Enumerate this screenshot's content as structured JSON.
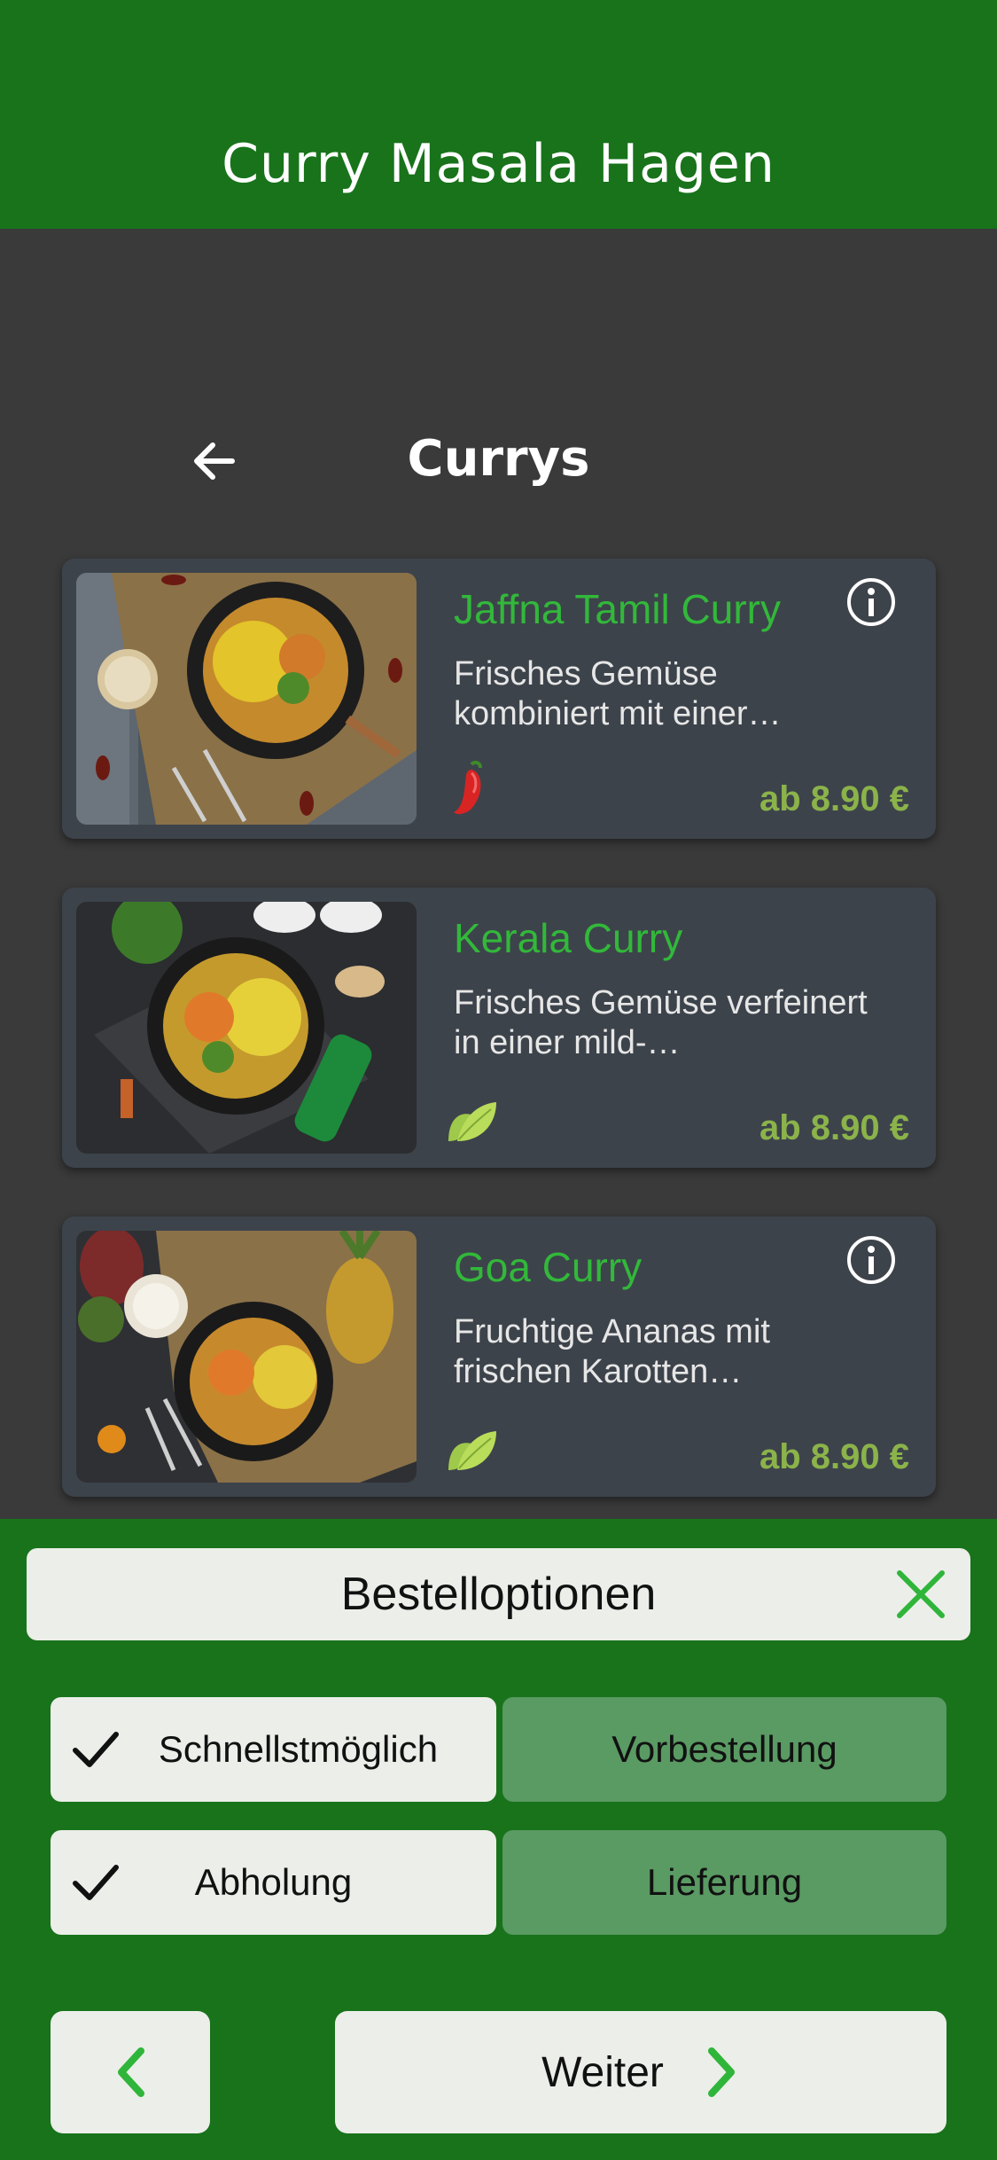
{
  "app": {
    "title": "Curry Masala Hagen",
    "brand_color": "#18731b",
    "accent_green": "#32b83a",
    "price_color": "#8bb34a"
  },
  "section": {
    "title": "Currys",
    "back_icon": "arrow-left-icon"
  },
  "menu_items": [
    {
      "name": "Jaffna Tamil Curry",
      "description": "Frisches Gemüse kombiniert mit einer…",
      "price": "ab 8.90 €",
      "tag_icon": "chili-icon",
      "has_info": true
    },
    {
      "name": "Kerala Curry",
      "description": "Frisches Gemüse verfeinert in einer mild-…",
      "price": "ab 8.90 €",
      "tag_icon": "vegan-leaf-icon",
      "has_info": false
    },
    {
      "name": "Goa Curry",
      "description": "Fruchtige Ananas mit frischen Karotten…",
      "price": "ab 8.90 €",
      "tag_icon": "vegan-leaf-icon",
      "has_info": true
    }
  ],
  "order_options": {
    "title": "Bestelloptionen",
    "timing": [
      {
        "label": "Schnellstmöglich",
        "selected": true
      },
      {
        "label": "Vorbestellung",
        "selected": false
      }
    ],
    "method": [
      {
        "label": "Abholung",
        "selected": true
      },
      {
        "label": "Lieferung",
        "selected": false
      }
    ],
    "next_label": "Weiter"
  }
}
